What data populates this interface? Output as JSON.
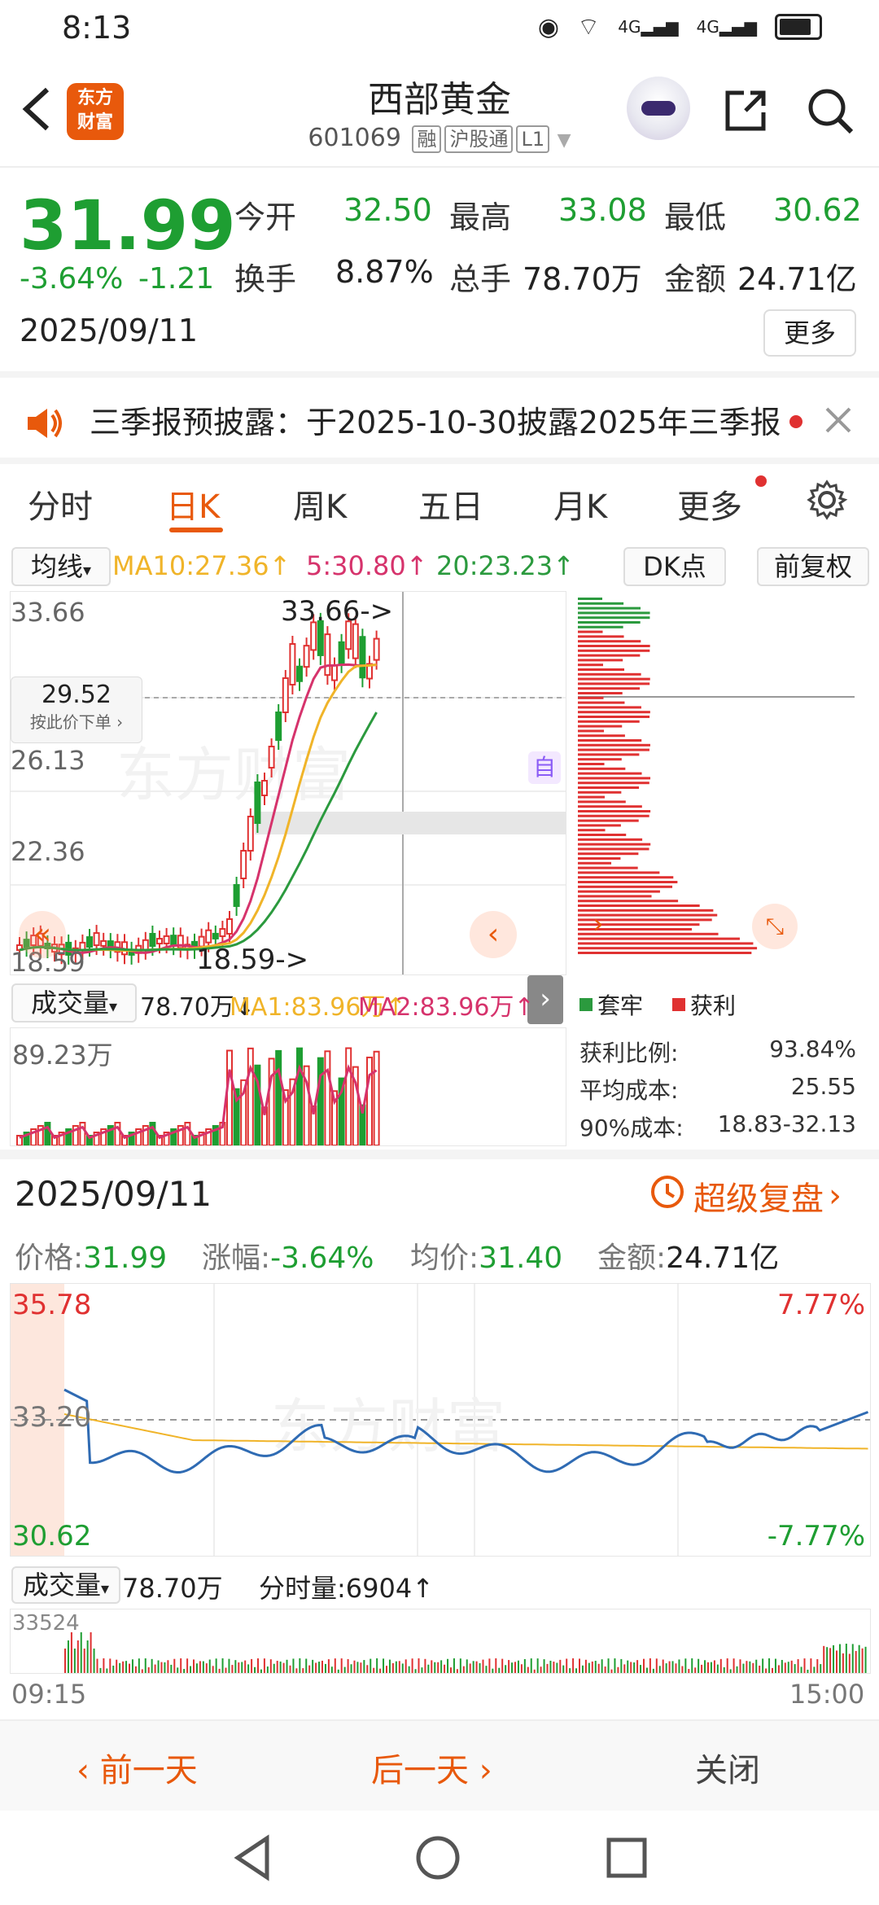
{
  "status_bar": {
    "time": "8:13",
    "net1": "4G",
    "net2": "4G"
  },
  "header": {
    "logo_text": "东方\n财富",
    "title": "西部黄金",
    "code": "601069",
    "tags": [
      "融",
      "沪股通",
      "L1"
    ]
  },
  "quote": {
    "price": "31.99",
    "change_pct": "-3.64%",
    "change": "-1.21",
    "date": "2025/09/11",
    "open_label": "今开",
    "open": "32.50",
    "high_label": "最高",
    "high": "33.08",
    "low_label": "最低",
    "low": "30.62",
    "turnover_label": "换手",
    "turnover": "8.87%",
    "volume_label": "总手",
    "volume": "78.70万",
    "amount_label": "金额",
    "amount": "24.71亿",
    "more_label": "更多"
  },
  "notice": {
    "text": "三季报预披露：于2025-10-30披露2025年三季报"
  },
  "tabs": [
    {
      "label": "分时"
    },
    {
      "label": "日K"
    },
    {
      "label": "周K"
    },
    {
      "label": "五日"
    },
    {
      "label": "月K"
    },
    {
      "label": "更多"
    }
  ],
  "indicators": {
    "select": "均线",
    "ma10": "MA10:27.36↑",
    "ma5": "5:30.80↑",
    "ma20": "20:23.23↑",
    "dk": "DK点",
    "adjust": "前复权"
  },
  "kline": {
    "y_labels": [
      "33.66",
      "26.13",
      "22.36",
      "18.59"
    ],
    "max_label": "33.66->",
    "min_label": "18.59->",
    "cursor_price": "29.52",
    "cursor_hint": "按此价下单",
    "auto_badge": "自",
    "watermark": "东方财富"
  },
  "volume": {
    "select": "成交量",
    "value": "78.70万↓",
    "ma1": "MA1:83.96万↑",
    "ma2": "MA2:83.96万↑",
    "max": "89.23万"
  },
  "chip": {
    "legend_trapped": "套牢",
    "legend_profit": "获利",
    "stats": [
      {
        "label": "获利比例:",
        "value": "93.84%"
      },
      {
        "label": "平均成本:",
        "value": "25.55"
      },
      {
        "label": "90%成本:",
        "value": "18.83-32.13"
      }
    ]
  },
  "intraday": {
    "date": "2025/09/11",
    "replay": "超级复盘",
    "price_label": "价格:",
    "price": "31.99",
    "change_label": "涨幅:",
    "change": "-3.64%",
    "avg_label": "均价:",
    "avg": "31.40",
    "amount_label": "金额:",
    "amount": "24.71亿",
    "y_max": "35.78",
    "y_mid": "33.20",
    "y_min": "30.62",
    "pct_max": "7.77%",
    "pct_min": "-7.77%",
    "vol_select": "成交量",
    "vol_value": "78.70万",
    "vol_per_min": "分时量:6904↑",
    "vol_max": "33524",
    "time_start": "09:15",
    "time_end": "15:00"
  },
  "bottom": {
    "prev": "前一天",
    "next": "后一天",
    "close": "关闭"
  },
  "colors": {
    "up": "#e03131",
    "down": "#1e9e32",
    "accent": "#e8590c",
    "ma5": "#d6336c",
    "ma10": "#f0b429",
    "ma20": "#2b9a3e"
  }
}
